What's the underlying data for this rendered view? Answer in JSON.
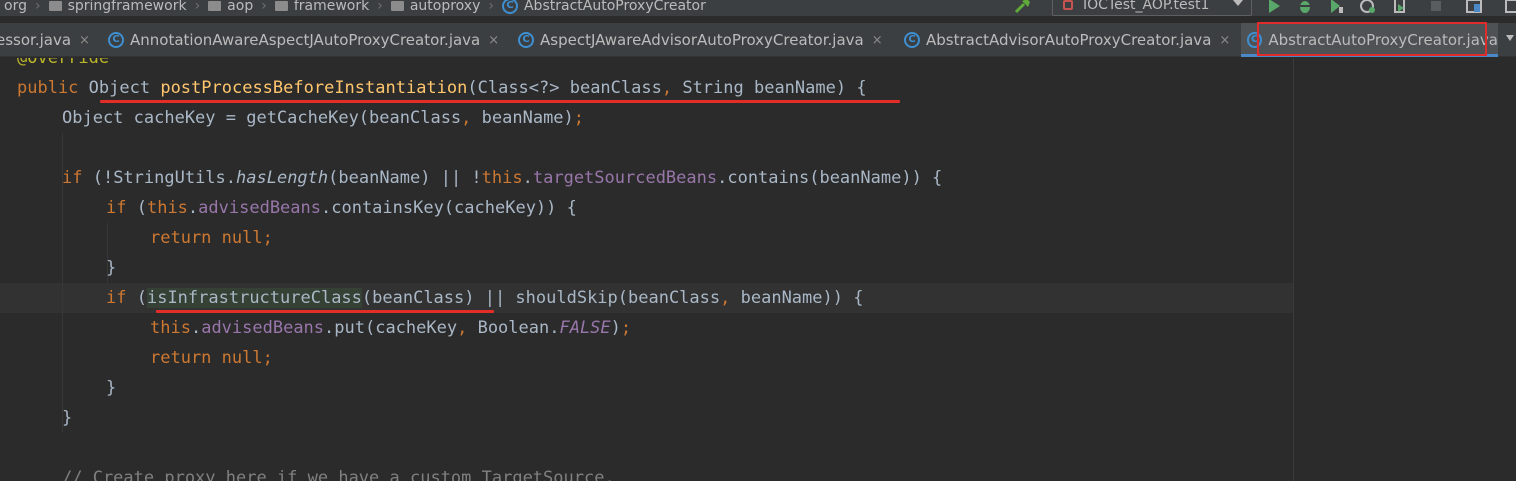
{
  "breadcrumb": {
    "items": [
      {
        "label": "org"
      },
      {
        "label": "springframework"
      },
      {
        "label": "aop"
      },
      {
        "label": "framework"
      },
      {
        "label": "autoproxy"
      },
      {
        "label": "AbstractAutoProxyCreator"
      }
    ]
  },
  "toolbar": {
    "run_config": "IOCTest_AOP.test1"
  },
  "tabs": [
    {
      "label": "essor.java",
      "close": "×"
    },
    {
      "label": "AnnotationAwareAspectJAutoProxyCreator.java",
      "close": "×"
    },
    {
      "label": "AspectJAwareAdvisorAutoProxyCreator.java",
      "close": "×"
    },
    {
      "label": "AbstractAdvisorAutoProxyCreator.java",
      "close": "×"
    },
    {
      "label": "AbstractAutoProxyCreator.java",
      "close": ""
    }
  ],
  "code": {
    "l0": {
      "ann": "@Override"
    },
    "l1": {
      "kw": "public ",
      "type": "Object",
      "sp": " ",
      "method": "postProcessBeforeInstantiation",
      "p1": "(Class<?> beanClass",
      "comma": ", ",
      "p2": "String beanName) {"
    },
    "l2": {
      "text": "Object cacheKey = getCacheKey(beanClass",
      "comma": ", ",
      "rest": "beanName)",
      "semi": ";"
    },
    "l4": {
      "kw": "if ",
      "a": "(!StringUtils.",
      "it": "hasLength",
      "b": "(beanName) || !",
      "this": "this",
      "dot": ".",
      "fld": "targetSourcedBeans",
      "c": ".contains(beanName)) {"
    },
    "l5": {
      "kw": "if ",
      "a": "(",
      "this": "this",
      "dot": ".",
      "fld": "advisedBeans",
      "c": ".containsKey(cacheKey)) {"
    },
    "l6": {
      "kw": "return null",
      "semi": ";"
    },
    "l7": {
      "text": "}"
    },
    "l8": {
      "kw": "if ",
      "a": "(",
      "hl": "isInfrastructureClass",
      "b": "(beanClass) || shouldSkip(beanClass",
      "comma": ", ",
      "c": "beanName)) {"
    },
    "l9": {
      "this": "this",
      "dot": ".",
      "fld": "advisedBeans",
      "a": ".put(cacheKey",
      "comma": ", ",
      "b": "Boolean.",
      "const": "FALSE",
      "c": ")",
      "semi": ";"
    },
    "l10": {
      "kw": "return null",
      "semi": ";"
    },
    "l11": {
      "text": "}"
    },
    "l12": {
      "text": "}"
    },
    "l14": {
      "comment": "// Create proxy here if we have a custom TargetSource."
    }
  }
}
